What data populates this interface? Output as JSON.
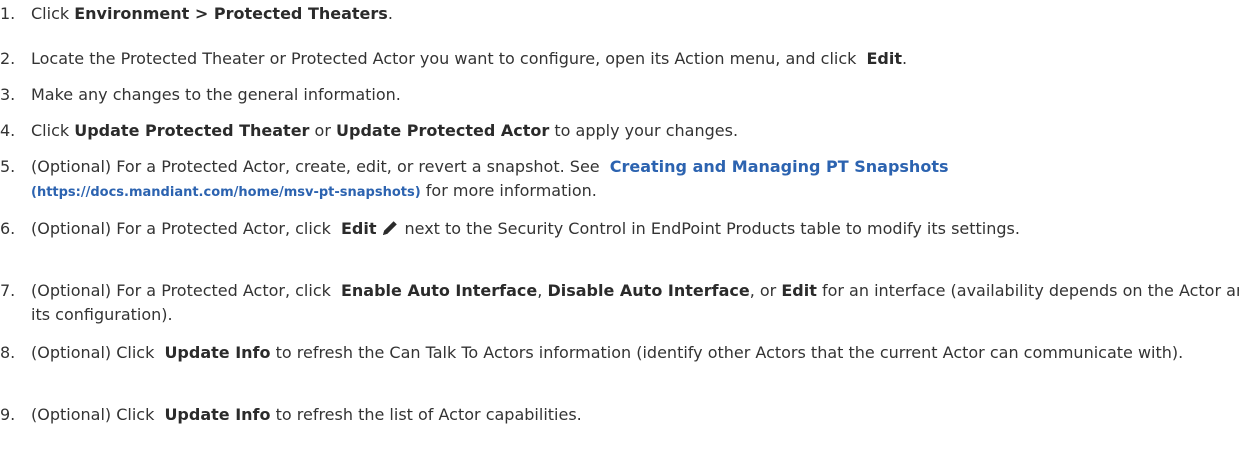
{
  "steps": [
    {
      "num": "1.",
      "parts": [
        "Click",
        "Environment > Protected Theaters",
        "."
      ]
    },
    {
      "num": "2.",
      "parts": [
        "Locate the Protected Theater or Protected Actor you want to configure, open its Action menu, and click",
        "Edit",
        "."
      ]
    },
    {
      "num": "3.",
      "parts": [
        "Make any changes to the general information."
      ]
    },
    {
      "num": "4.",
      "parts": [
        "Click",
        "Update Protected Theater",
        "or",
        "Update Protected Actor",
        "to apply your changes."
      ]
    },
    {
      "num": "5.",
      "parts": [
        "(Optional) For a Protected Actor, create, edit, or revert a snapshot. See",
        "Creating and Managing PT Snapshots",
        "(https://docs.mandiant.com/home/msv-pt-snapshots)",
        "for more information."
      ]
    },
    {
      "num": "6.",
      "parts": [
        "(Optional) For a Protected Actor, click",
        "Edit",
        "next to the Security Control in EndPoint Products table to modify its settings."
      ],
      "icon": "pencil-icon"
    },
    {
      "num": "7.",
      "parts": [
        "(Optional) For a Protected Actor, click",
        "Enable Auto Interface",
        ",",
        "Disable Auto Interface",
        ", or",
        "Edit",
        "for an interface (availability depends on the Actor and its configuration)."
      ]
    },
    {
      "num": "8.",
      "parts": [
        "(Optional) Click",
        "Update Info",
        "to refresh the Can Talk To Actors information (identify other Actors that the current Actor can communicate with)."
      ]
    },
    {
      "num": "9.",
      "parts": [
        "(Optional) Click",
        "Update Info",
        "to refresh the list of Actor capabilities."
      ]
    }
  ],
  "colors": {
    "text": "#333333",
    "link": "#2c63b0"
  }
}
